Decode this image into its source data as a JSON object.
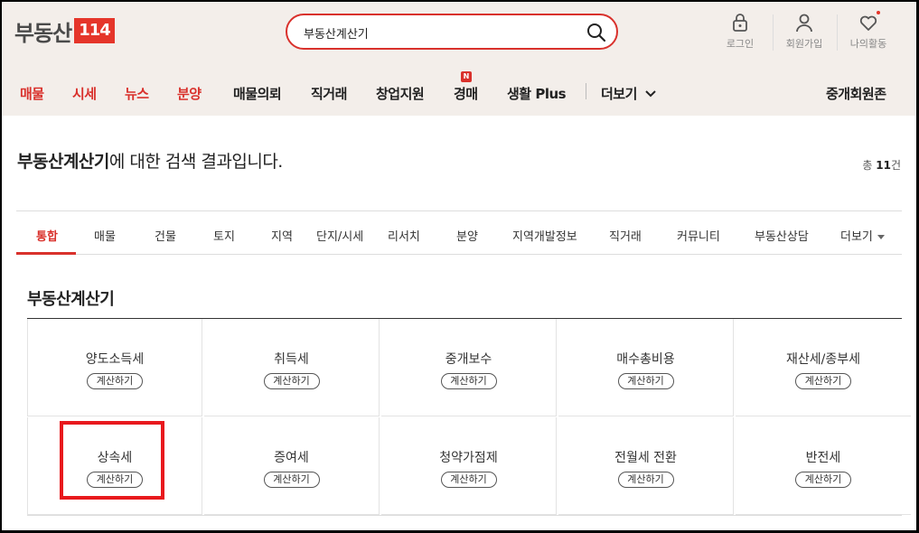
{
  "header": {
    "logo_text": "부동산",
    "logo_box": "114",
    "search": {
      "value": "부동산계산기"
    },
    "utils": [
      {
        "label": "로그인",
        "icon": "lock-icon"
      },
      {
        "label": "회원가입",
        "icon": "person-icon"
      },
      {
        "label": "나의활동",
        "icon": "heart-icon"
      }
    ]
  },
  "gnb": {
    "items": [
      "매물",
      "시세",
      "뉴스",
      "분양",
      "매물의뢰",
      "직거래",
      "창업지원",
      "경매",
      "생활 Plus",
      "더보기"
    ],
    "new_badge": "N",
    "right": "중개회원존"
  },
  "result": {
    "keyword": "부동산계산기",
    "suffix": "에 대한 검색 결과입니다.",
    "count_prefix": "총 ",
    "count": "11",
    "count_suffix": "건"
  },
  "tabs": [
    "통합",
    "매물",
    "건물",
    "토지",
    "지역",
    "단지/시세",
    "리서치",
    "분양",
    "지역개발정보",
    "직거래",
    "커뮤니티",
    "부동산상담",
    "더보기"
  ],
  "section": {
    "title": "부동산계산기",
    "button_label": "계산하기",
    "calculators": [
      "양도소득세",
      "취득세",
      "중개보수",
      "매수총비용",
      "재산세/종부세",
      "상속세",
      "증여세",
      "청약가점제",
      "전월세 전환",
      "반전세"
    ]
  },
  "colors": {
    "accent": "#d9312c",
    "highlight": "#e8191d",
    "header_bg": "#f3eeea"
  }
}
